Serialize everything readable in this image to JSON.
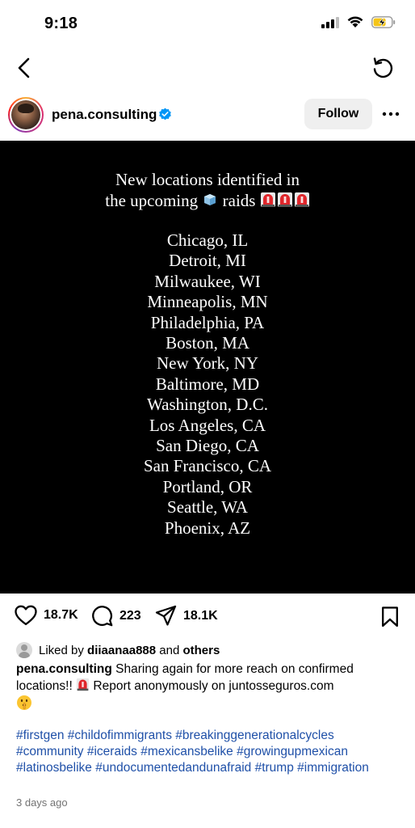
{
  "status_bar": {
    "time": "9:18"
  },
  "post": {
    "username": "pena.consulting",
    "follow_label": "Follow",
    "image": {
      "heading_line1": "New locations identified in",
      "heading_line2_before": "the upcoming",
      "heading_line2_after": "raids",
      "cities": [
        "Chicago, IL",
        "Detroit, MI",
        "Milwaukee, WI",
        "Minneapolis, MN",
        "Philadelphia, PA",
        "Boston, MA",
        "New York, NY",
        "Baltimore, MD",
        "Washington, D.C.",
        "Los Angeles, CA",
        "San Diego, CA",
        "San Francisco, CA",
        "Portland, OR",
        "Seattle, WA",
        "Phoenix, AZ"
      ]
    },
    "actions": {
      "likes": "18.7K",
      "comments": "223",
      "shares": "18.1K"
    },
    "liked_by": {
      "prefix": "Liked by",
      "user": "diiaanaa888",
      "conjunction": "and",
      "others": "others"
    },
    "caption": {
      "username": "pena.consulting",
      "text_part1": "Sharing again for more reach on confirmed locations!!",
      "text_part2": "Report anonymously on juntosseguros.com"
    },
    "hashtags": "#firstgen #childofimmigrants #breakinggenerationalcycles #community #iceraids #mexicansbelike #growingupmexican #latinosbelike #undocumentedandunafraid #trump #immigration",
    "timestamp": "3 days ago"
  },
  "icons": {
    "status": [
      "cellular-signal-icon",
      "wifi-icon",
      "battery-charging-icon"
    ],
    "nav": [
      "back-chevron-icon",
      "refresh-icon"
    ],
    "actions": [
      "heart-icon",
      "comment-bubble-icon",
      "share-paper-plane-icon",
      "bookmark-icon"
    ],
    "emoji": [
      "ice-cube-emoji",
      "police-siren-emoji",
      "shushing-face-emoji"
    ]
  },
  "colors": {
    "hashtag": "#1f50a8",
    "verified": "#0095f6",
    "follow_bg": "#efefef",
    "image_bg": "#000000",
    "timestamp": "#737373"
  }
}
